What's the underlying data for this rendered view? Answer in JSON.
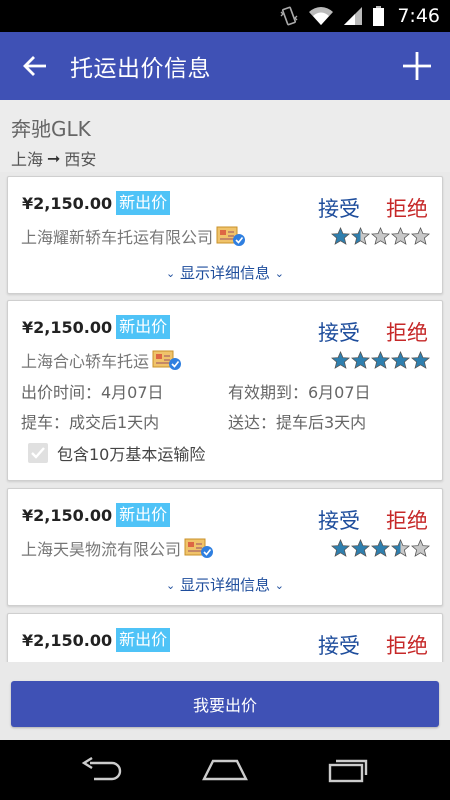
{
  "status_bar": {
    "time": "7:46"
  },
  "app_bar": {
    "title": "托运出价信息"
  },
  "car": {
    "name": "奔驰GLK",
    "from": "上海",
    "arrow": "➞",
    "to": "西安"
  },
  "offers": [
    {
      "price": "¥2,150.00",
      "badge": "新出价",
      "company": "上海耀新轿车托运有限公司",
      "accept": "接受",
      "reject": "拒绝",
      "rating": 1.5,
      "toggle": "显示详细信息"
    },
    {
      "price": "¥2,150.00",
      "badge": "新出价",
      "company": "上海合心轿车托运",
      "accept": "接受",
      "reject": "拒绝",
      "rating": 5,
      "bid_time": "出价时间：4月07日",
      "valid_until": "有效期到：6月07日",
      "pickup": "提车：成交后1天内",
      "delivery": "送达：提车后3天内",
      "insurance": "包含10万基本运输险"
    },
    {
      "price": "¥2,150.00",
      "badge": "新出价",
      "company": "上海天昊物流有限公司",
      "accept": "接受",
      "reject": "拒绝",
      "rating": 3.5,
      "toggle": "显示详细信息"
    },
    {
      "price": "¥2,150.00",
      "badge": "新出价",
      "accept": "接受",
      "reject": "拒绝"
    }
  ],
  "bid_button": "我要出价",
  "colors": {
    "primary": "#3f51b5",
    "accept": "#1e4d9c",
    "reject": "#c62828",
    "badge": "#4fc3f7",
    "star": "#2f7fae"
  },
  "icons": [
    "back-arrow-icon",
    "add-icon",
    "cert-icon",
    "star-icon",
    "chevron-down-icon",
    "check-icon",
    "nav-back-icon",
    "nav-home-icon",
    "nav-recents-icon"
  ]
}
